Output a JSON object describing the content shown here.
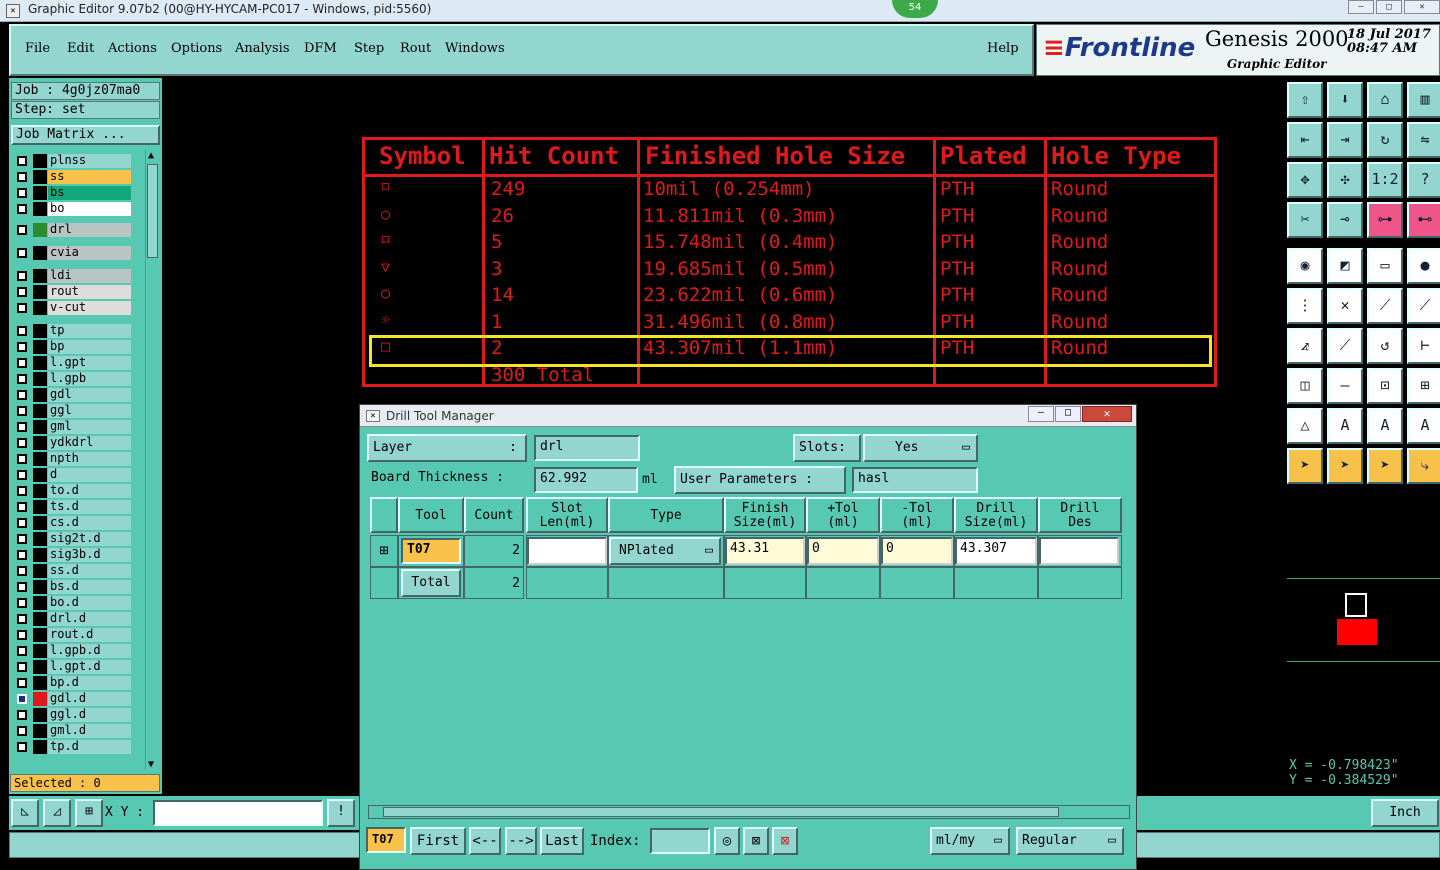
{
  "window": {
    "title": "Graphic Editor 9.07b2 (00@HY-HYCAM-PC017 - Windows, pid:5560)",
    "badge": "54",
    "controls": [
      "–",
      "□",
      "✕"
    ]
  },
  "menu": {
    "items": [
      "File",
      "Edit",
      "Actions",
      "Options",
      "Analysis",
      "DFM",
      "Step",
      "Rout",
      "Windows"
    ],
    "help": "Help"
  },
  "brand": {
    "company": "Frontline",
    "product": "Genesis 2000",
    "module": "Graphic Editor",
    "date": "18 Jul 2017",
    "time": "08:47 AM"
  },
  "job": {
    "job_label": "Job : 4g0jz07ma0",
    "step_label": "Step: set",
    "matrix_button": "Job Matrix ..."
  },
  "layers": [
    {
      "name": "plnss",
      "color": "#000000",
      "bg": "#93d6d0",
      "arrow": ""
    },
    {
      "name": "ss",
      "color": "#000000",
      "bg": "#f8c24a",
      "arrow": ""
    },
    {
      "name": "bs",
      "color": "#000000",
      "bg": "#14a77b",
      "arrow": ""
    },
    {
      "name": "bo",
      "color": "#000000",
      "bg": "#ffffff",
      "arrow": ""
    },
    {
      "name": "drl",
      "color": "#2e8b2e",
      "bg": "#b7c4c2",
      "arrow": ""
    },
    {
      "name": "cvia",
      "color": "#000000",
      "bg": "#b7c4c2",
      "arrow": ""
    },
    {
      "name": "ldi",
      "color": "#000000",
      "bg": "#b7c4c2",
      "arrow": ""
    },
    {
      "name": "rout",
      "color": "#000000",
      "bg": "#dddddd",
      "arrow": ""
    },
    {
      "name": "v-cut",
      "color": "#000000",
      "bg": "#dddddd",
      "arrow": ""
    },
    {
      "name": "tp",
      "color": "#000000",
      "bg": "#93d6d0",
      "arrow": ""
    },
    {
      "name": "bp",
      "color": "#000000",
      "bg": "#93d6d0",
      "arrow": ""
    },
    {
      "name": "l.gpt",
      "color": "#000000",
      "bg": "#93d6d0",
      "arrow": ""
    },
    {
      "name": "l.gpb",
      "color": "#000000",
      "bg": "#93d6d0",
      "arrow": ""
    },
    {
      "name": "gdl",
      "color": "#000000",
      "bg": "#93d6d0",
      "arrow": ""
    },
    {
      "name": "ggl",
      "color": "#000000",
      "bg": "#93d6d0",
      "arrow": ""
    },
    {
      "name": "gml",
      "color": "#000000",
      "bg": "#93d6d0",
      "arrow": ""
    },
    {
      "name": "ydkdrl",
      "color": "#000000",
      "bg": "#93d6d0",
      "arrow": ""
    },
    {
      "name": "npth",
      "color": "#000000",
      "bg": "#93d6d0",
      "arrow": ""
    },
    {
      "name": "d",
      "color": "#000000",
      "bg": "#93d6d0",
      "arrow": ""
    },
    {
      "name": "to.d",
      "color": "#000000",
      "bg": "#93d6d0",
      "arrow": "⬋"
    },
    {
      "name": "ts.d",
      "color": "#000000",
      "bg": "#93d6d0",
      "arrow": ""
    },
    {
      "name": "cs.d",
      "color": "#000000",
      "bg": "#93d6d0",
      "arrow": "⬋"
    },
    {
      "name": "sig2t.d",
      "color": "#000000",
      "bg": "#93d6d0",
      "arrow": "⬋"
    },
    {
      "name": "sig3b.d",
      "color": "#000000",
      "bg": "#93d6d0",
      "arrow": "⬋"
    },
    {
      "name": "ss.d",
      "color": "#000000",
      "bg": "#93d6d0",
      "arrow": "⬋"
    },
    {
      "name": "bs.d",
      "color": "#000000",
      "bg": "#93d6d0",
      "arrow": ""
    },
    {
      "name": "bo.d",
      "color": "#000000",
      "bg": "#93d6d0",
      "arrow": "⬋"
    },
    {
      "name": "drl.d",
      "color": "#000000",
      "bg": "#93d6d0",
      "arrow": ""
    },
    {
      "name": "rout.d",
      "color": "#000000",
      "bg": "#93d6d0",
      "arrow": ""
    },
    {
      "name": "l.gpb.d",
      "color": "#000000",
      "bg": "#93d6d0",
      "arrow": ""
    },
    {
      "name": "l.gpt.d",
      "color": "#000000",
      "bg": "#93d6d0",
      "arrow": ""
    },
    {
      "name": "bp.d",
      "color": "#000000",
      "bg": "#93d6d0",
      "arrow": ""
    },
    {
      "name": "gdl.d",
      "color": "#e01a1a",
      "bg": "#93d6d0",
      "arrow": "⬋⊗"
    },
    {
      "name": "ggl.d",
      "color": "#000000",
      "bg": "#93d6d0",
      "arrow": ""
    },
    {
      "name": "gml.d",
      "color": "#000000",
      "bg": "#93d6d0",
      "arrow": "⬋"
    },
    {
      "name": "tp.d",
      "color": "#000000",
      "bg": "#93d6d0",
      "arrow": ""
    }
  ],
  "selected": "Selected : 0",
  "drill_table": {
    "headers": [
      "Symbol",
      "Hit Count",
      "Finished Hole Size",
      "Plated",
      "Hole Type"
    ],
    "rows": [
      {
        "symbol": "⌑",
        "count": "249",
        "size": "10mil (0.254mm)",
        "plated": "PTH",
        "type": "Round"
      },
      {
        "symbol": "○",
        "count": "26",
        "size": "11.811mil (0.3mm)",
        "plated": "PTH",
        "type": "Round"
      },
      {
        "symbol": "⌑",
        "count": "5",
        "size": "15.748mil (0.4mm)",
        "plated": "PTH",
        "type": "Round"
      },
      {
        "symbol": "▽",
        "count": "3",
        "size": "19.685mil (0.5mm)",
        "plated": "PTH",
        "type": "Round"
      },
      {
        "symbol": "○",
        "count": "14",
        "size": "23.622mil (0.6mm)",
        "plated": "PTH",
        "type": "Round"
      },
      {
        "symbol": "☼",
        "count": "1",
        "size": "31.496mil (0.8mm)",
        "plated": "PTH",
        "type": "Round"
      },
      {
        "symbol": "□",
        "count": "2",
        "size": "43.307mil (1.1mm)",
        "plated": "PTH",
        "type": "Round"
      }
    ],
    "total": "300 Total"
  },
  "coords": {
    "x": "X = -0.798423\"",
    "y": "Y = -0.384529\""
  },
  "xy_label": "X Y :",
  "units": "Inch",
  "dialog": {
    "title": "Drill Tool Manager",
    "layer_label": "Layer",
    "layer_colon": ":",
    "layer_value": "drl",
    "slots_label": "Slots:",
    "slots_value": "Yes",
    "thickness_label": "Board Thickness :",
    "thickness_value": "62.992",
    "thickness_unit": "ml",
    "userparams_label": "User Parameters :",
    "userparams_value": "hasl",
    "columns": [
      "Tool",
      "Count",
      "Slot\nLen(ml)",
      "Type",
      "Finish\nSize(ml)",
      "+Tol\n(ml)",
      "-Tol\n(ml)",
      "Drill\nSize(ml)",
      "Drill\nDes"
    ],
    "row": {
      "tool": "T07",
      "count": "2",
      "slot_len": "",
      "type": "NPlated",
      "finish": "43.31",
      "ptol": "0",
      "mtol": "0",
      "drill": "43.307",
      "des": ""
    },
    "total_label": "Total",
    "total_count": "2",
    "nav": {
      "tool": "T07",
      "first": "First",
      "prev": "<--",
      "next": "-->",
      "last": "Last",
      "index_label": "Index:",
      "units": "ml/my",
      "mode": "Regular"
    }
  }
}
